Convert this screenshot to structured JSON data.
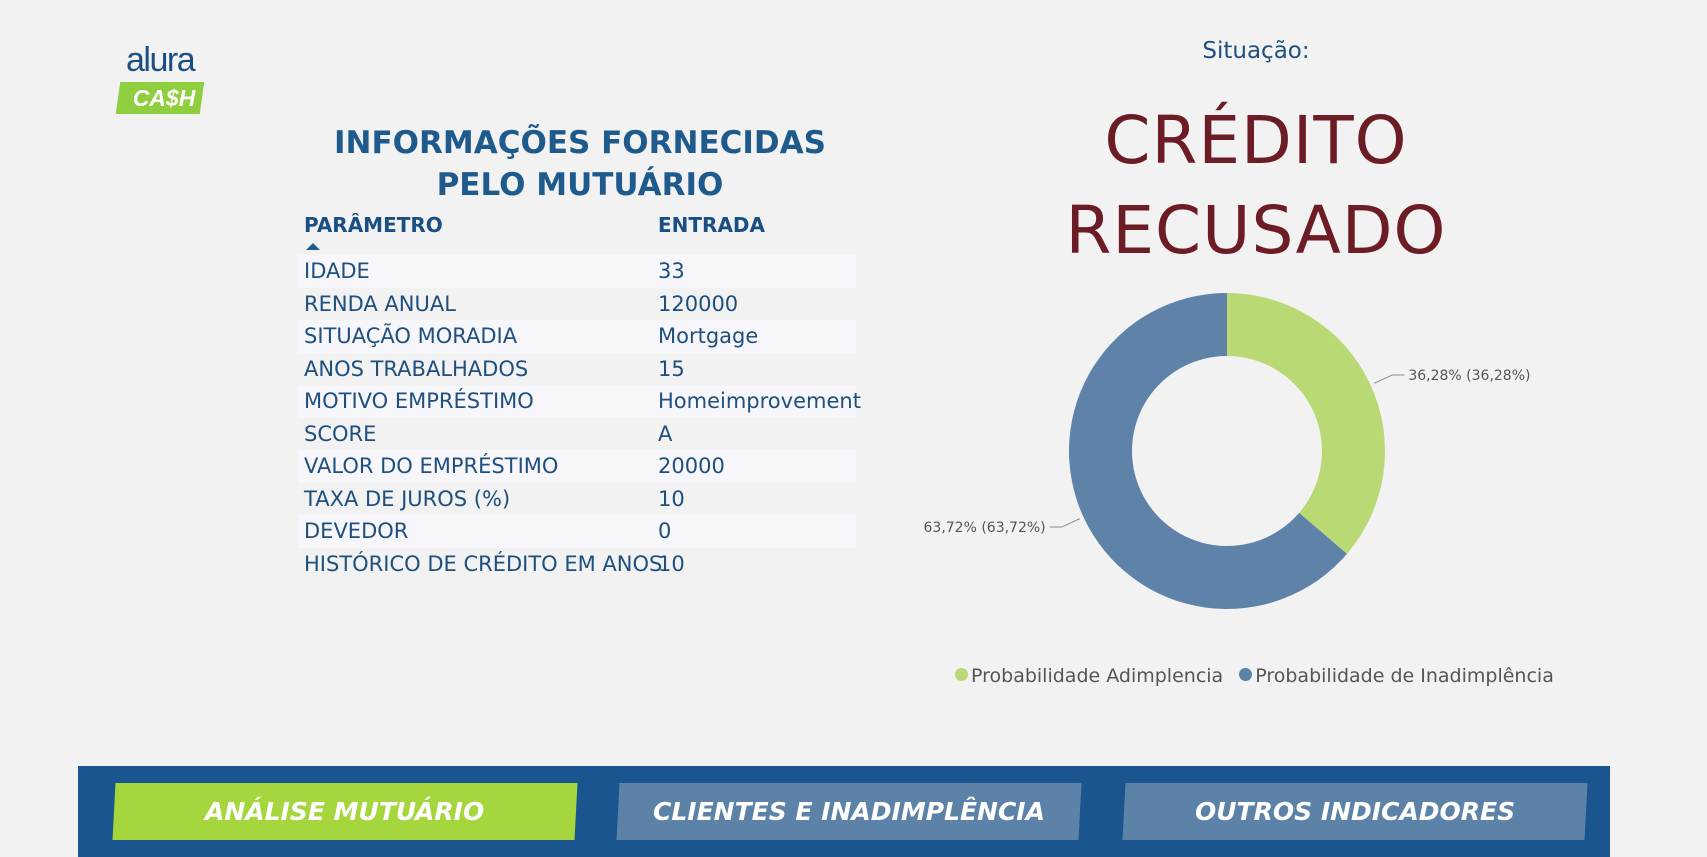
{
  "logo": {
    "word": "alura",
    "badge": "CA$H"
  },
  "panel": {
    "title": "INFORMAÇÕES FORNECIDAS PELO MUTUÁRIO",
    "columns": {
      "param": "PARÂMETRO",
      "value": "ENTRADA"
    },
    "rows": [
      {
        "param": "IDADE",
        "value": "33"
      },
      {
        "param": "RENDA ANUAL",
        "value": "120000"
      },
      {
        "param": "SITUAÇÃO MORADIA",
        "value": "Mortgage"
      },
      {
        "param": "ANOS TRABALHADOS",
        "value": "15"
      },
      {
        "param": "MOTIVO EMPRÉSTIMO",
        "value": "Homeimprovement"
      },
      {
        "param": "SCORE",
        "value": "A"
      },
      {
        "param": "VALOR DO EMPRÉSTIMO",
        "value": "20000"
      },
      {
        "param": "TAXA DE JUROS (%)",
        "value": "10"
      },
      {
        "param": "DEVEDOR",
        "value": "0"
      },
      {
        "param": "HISTÓRICO DE CRÉDITO EM ANOS",
        "value": "10"
      }
    ]
  },
  "status": {
    "label": "Situação:",
    "value": "CRÉDITO RECUSADO"
  },
  "chart_data": {
    "type": "pie",
    "donut": true,
    "categories": [
      "Probabilidade Adimplencia",
      "Probabilidade de Inadimplência"
    ],
    "values": [
      36.28,
      63.72
    ],
    "data_labels": [
      "36,28% (36,28%)",
      "63,72% (63,72%)"
    ],
    "colors": [
      "#b8d974",
      "#5e82a8"
    ],
    "legend_position": "bottom"
  },
  "nav": {
    "tabs": [
      {
        "label": "ANÁLISE MUTUÁRIO",
        "active": true
      },
      {
        "label": "CLIENTES E INADIMPLÊNCIA",
        "active": false
      },
      {
        "label": "OUTROS INDICADORES",
        "active": false
      }
    ]
  }
}
